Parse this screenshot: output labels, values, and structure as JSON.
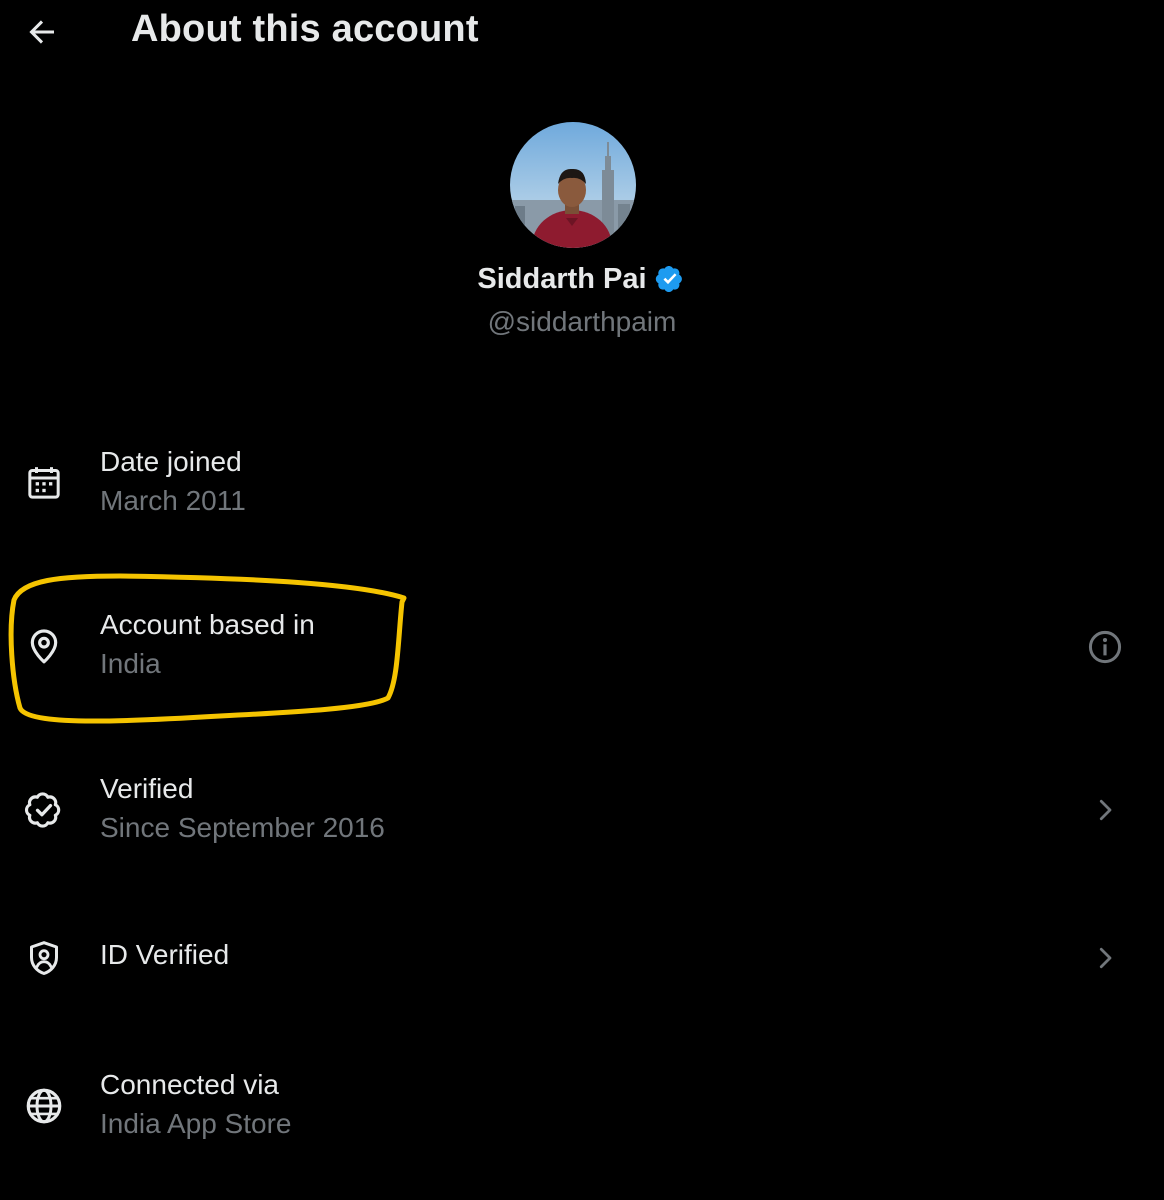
{
  "header": {
    "title": "About this account",
    "back_icon": "arrow-left-icon"
  },
  "profile": {
    "display_name": "Siddarth Pai",
    "handle": "@siddarthpaim",
    "verified_badge_color": "#1d9bf0"
  },
  "rows": [
    {
      "icon": "calendar-icon",
      "label": "Date joined",
      "value": "March 2011",
      "trailing": ""
    },
    {
      "icon": "location-pin-icon",
      "label": "Account based in",
      "value": "India",
      "trailing": "info-icon"
    },
    {
      "icon": "verified-badge-icon",
      "label": "Verified",
      "value": "Since September 2016",
      "trailing": "chevron-right-icon"
    },
    {
      "icon": "id-shield-icon",
      "label": "ID Verified",
      "value": "",
      "trailing": "chevron-right-icon"
    },
    {
      "icon": "globe-icon",
      "label": "Connected via",
      "value": "India App Store",
      "trailing": ""
    }
  ],
  "annotation": {
    "color": "#f5c400"
  }
}
